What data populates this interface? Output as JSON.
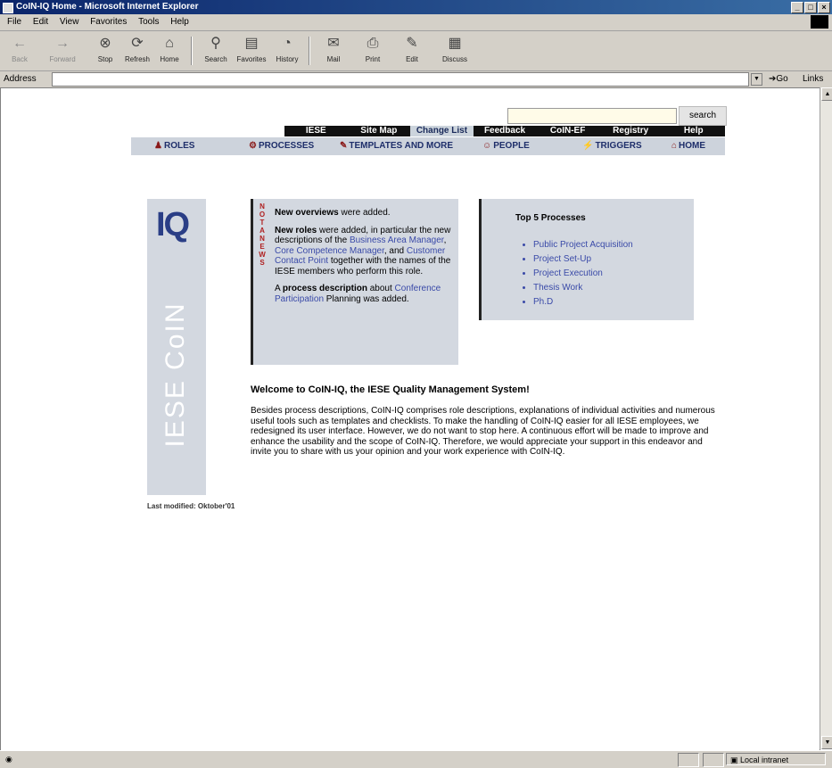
{
  "window": {
    "title": "CoIN-IQ Home - Microsoft Internet Explorer"
  },
  "menu": [
    "File",
    "Edit",
    "View",
    "Favorites",
    "Tools",
    "Help"
  ],
  "toolbar": {
    "back": "Back",
    "forward": "Forward",
    "stop": "Stop",
    "refresh": "Refresh",
    "home": "Home",
    "search": "Search",
    "favorites": "Favorites",
    "history": "History",
    "mail": "Mail",
    "print": "Print",
    "edit": "Edit",
    "discuss": "Discuss"
  },
  "address": {
    "label": "Address",
    "value": "",
    "go": "Go",
    "links": "Links"
  },
  "search": {
    "button": "search",
    "value": ""
  },
  "topnav": [
    "IESE",
    "Site Map",
    "Change List",
    "Feedback",
    "CoIN-EF",
    "Registry",
    "Help"
  ],
  "mainnav": {
    "roles": "ROLES",
    "processes": "PROCESSES",
    "templates": "TEMPLATES AND MORE",
    "people": "PEOPLE",
    "triggers": "TRIGGERS",
    "home": "HOME"
  },
  "logo": {
    "iq": "IQ",
    "vertical": "IESE CoIN"
  },
  "news": {
    "vertical": "NOT A NEWS",
    "p1_bold": "New overviews",
    "p1_rest": " were added.",
    "p2_bold": "New roles",
    "p2_a": " were added, in particular the new descriptions of the ",
    "p2_link1": "Business Area Manager",
    "p2_b": ", ",
    "p2_link2": "Core Competence Manager",
    "p2_c": ", and ",
    "p2_link3": "Customer Contact Point",
    "p2_d": " together with the names of the IESE members who perform this role.",
    "p3_a": "A ",
    "p3_bold": "process description",
    "p3_b": " about ",
    "p3_link": "Conference Participation",
    "p3_c": " Planning was added."
  },
  "top_processes": {
    "title": "Top 5 Processes",
    "items": [
      "Public Project Acquisition",
      "Project Set-Up",
      "Project Execution",
      "Thesis Work",
      "Ph.D"
    ]
  },
  "welcome": {
    "title": "Welcome to CoIN-IQ, the IESE Quality Management System!",
    "body": "Besides process descriptions, CoIN-IQ comprises role descriptions, explanations of individual activities and numerous useful tools such as templates and checklists. To make the handling of CoIN-IQ easier for all IESE employees, we redesigned its user interface. However, we do not want to stop here. A continuous effort will be made to improve and enhance the usability and the scope of CoIN-IQ. Therefore, we would appreciate your support in this endeavor and invite you to share with us your opinion and your work experience with CoIN-IQ."
  },
  "last_modified": "Last modified: Oktober'01",
  "status": {
    "zone": "Local intranet"
  }
}
